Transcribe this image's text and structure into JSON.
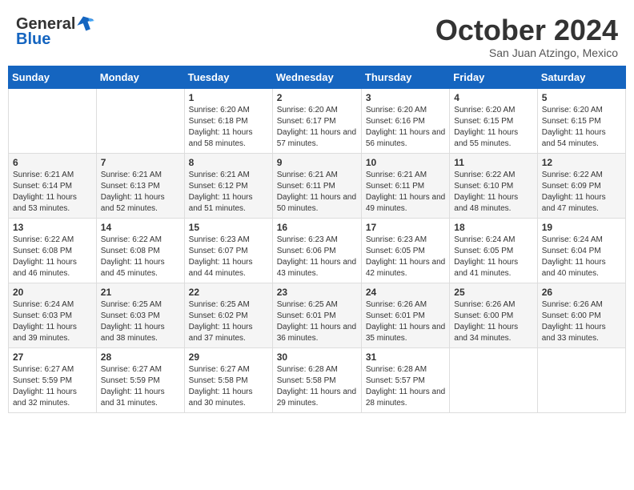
{
  "header": {
    "logo_general": "General",
    "logo_blue": "Blue",
    "month_title": "October 2024",
    "location": "San Juan Atzingo, Mexico"
  },
  "calendar": {
    "days_of_week": [
      "Sunday",
      "Monday",
      "Tuesday",
      "Wednesday",
      "Thursday",
      "Friday",
      "Saturday"
    ],
    "weeks": [
      [
        {
          "day": "",
          "info": ""
        },
        {
          "day": "",
          "info": ""
        },
        {
          "day": "1",
          "info": "Sunrise: 6:20 AM\nSunset: 6:18 PM\nDaylight: 11 hours and 58 minutes."
        },
        {
          "day": "2",
          "info": "Sunrise: 6:20 AM\nSunset: 6:17 PM\nDaylight: 11 hours and 57 minutes."
        },
        {
          "day": "3",
          "info": "Sunrise: 6:20 AM\nSunset: 6:16 PM\nDaylight: 11 hours and 56 minutes."
        },
        {
          "day": "4",
          "info": "Sunrise: 6:20 AM\nSunset: 6:15 PM\nDaylight: 11 hours and 55 minutes."
        },
        {
          "day": "5",
          "info": "Sunrise: 6:20 AM\nSunset: 6:15 PM\nDaylight: 11 hours and 54 minutes."
        }
      ],
      [
        {
          "day": "6",
          "info": "Sunrise: 6:21 AM\nSunset: 6:14 PM\nDaylight: 11 hours and 53 minutes."
        },
        {
          "day": "7",
          "info": "Sunrise: 6:21 AM\nSunset: 6:13 PM\nDaylight: 11 hours and 52 minutes."
        },
        {
          "day": "8",
          "info": "Sunrise: 6:21 AM\nSunset: 6:12 PM\nDaylight: 11 hours and 51 minutes."
        },
        {
          "day": "9",
          "info": "Sunrise: 6:21 AM\nSunset: 6:11 PM\nDaylight: 11 hours and 50 minutes."
        },
        {
          "day": "10",
          "info": "Sunrise: 6:21 AM\nSunset: 6:11 PM\nDaylight: 11 hours and 49 minutes."
        },
        {
          "day": "11",
          "info": "Sunrise: 6:22 AM\nSunset: 6:10 PM\nDaylight: 11 hours and 48 minutes."
        },
        {
          "day": "12",
          "info": "Sunrise: 6:22 AM\nSunset: 6:09 PM\nDaylight: 11 hours and 47 minutes."
        }
      ],
      [
        {
          "day": "13",
          "info": "Sunrise: 6:22 AM\nSunset: 6:08 PM\nDaylight: 11 hours and 46 minutes."
        },
        {
          "day": "14",
          "info": "Sunrise: 6:22 AM\nSunset: 6:08 PM\nDaylight: 11 hours and 45 minutes."
        },
        {
          "day": "15",
          "info": "Sunrise: 6:23 AM\nSunset: 6:07 PM\nDaylight: 11 hours and 44 minutes."
        },
        {
          "day": "16",
          "info": "Sunrise: 6:23 AM\nSunset: 6:06 PM\nDaylight: 11 hours and 43 minutes."
        },
        {
          "day": "17",
          "info": "Sunrise: 6:23 AM\nSunset: 6:05 PM\nDaylight: 11 hours and 42 minutes."
        },
        {
          "day": "18",
          "info": "Sunrise: 6:24 AM\nSunset: 6:05 PM\nDaylight: 11 hours and 41 minutes."
        },
        {
          "day": "19",
          "info": "Sunrise: 6:24 AM\nSunset: 6:04 PM\nDaylight: 11 hours and 40 minutes."
        }
      ],
      [
        {
          "day": "20",
          "info": "Sunrise: 6:24 AM\nSunset: 6:03 PM\nDaylight: 11 hours and 39 minutes."
        },
        {
          "day": "21",
          "info": "Sunrise: 6:25 AM\nSunset: 6:03 PM\nDaylight: 11 hours and 38 minutes."
        },
        {
          "day": "22",
          "info": "Sunrise: 6:25 AM\nSunset: 6:02 PM\nDaylight: 11 hours and 37 minutes."
        },
        {
          "day": "23",
          "info": "Sunrise: 6:25 AM\nSunset: 6:01 PM\nDaylight: 11 hours and 36 minutes."
        },
        {
          "day": "24",
          "info": "Sunrise: 6:26 AM\nSunset: 6:01 PM\nDaylight: 11 hours and 35 minutes."
        },
        {
          "day": "25",
          "info": "Sunrise: 6:26 AM\nSunset: 6:00 PM\nDaylight: 11 hours and 34 minutes."
        },
        {
          "day": "26",
          "info": "Sunrise: 6:26 AM\nSunset: 6:00 PM\nDaylight: 11 hours and 33 minutes."
        }
      ],
      [
        {
          "day": "27",
          "info": "Sunrise: 6:27 AM\nSunset: 5:59 PM\nDaylight: 11 hours and 32 minutes."
        },
        {
          "day": "28",
          "info": "Sunrise: 6:27 AM\nSunset: 5:59 PM\nDaylight: 11 hours and 31 minutes."
        },
        {
          "day": "29",
          "info": "Sunrise: 6:27 AM\nSunset: 5:58 PM\nDaylight: 11 hours and 30 minutes."
        },
        {
          "day": "30",
          "info": "Sunrise: 6:28 AM\nSunset: 5:58 PM\nDaylight: 11 hours and 29 minutes."
        },
        {
          "day": "31",
          "info": "Sunrise: 6:28 AM\nSunset: 5:57 PM\nDaylight: 11 hours and 28 minutes."
        },
        {
          "day": "",
          "info": ""
        },
        {
          "day": "",
          "info": ""
        }
      ]
    ]
  }
}
